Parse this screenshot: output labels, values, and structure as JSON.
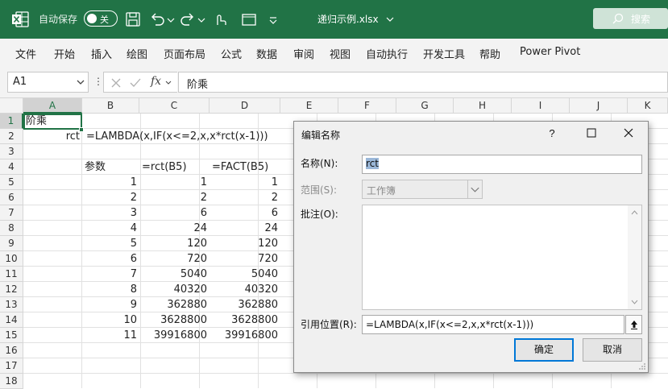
{
  "titlebar": {
    "autosave_label": "自动保存",
    "autosave_state": "关",
    "filename": "递归示例.xlsx",
    "search_label": "搜索",
    "accent": "#217346"
  },
  "menu": {
    "items": [
      "文件",
      "开始",
      "插入",
      "绘图",
      "页面布局",
      "公式",
      "数据",
      "审阅",
      "视图",
      "自动执行",
      "开发工具",
      "帮助",
      "Power Pivot"
    ]
  },
  "formula_bar": {
    "name_box": "A1",
    "dots": "⋮",
    "fx_label": "fx",
    "content": "阶乘"
  },
  "grid": {
    "columns": [
      "A",
      "B",
      "C",
      "D",
      "E",
      "F",
      "G",
      "H",
      "I",
      "J",
      "K"
    ],
    "rows": [
      "1",
      "2",
      "3",
      "4",
      "5",
      "6",
      "7",
      "8",
      "9",
      "10",
      "11",
      "12",
      "13",
      "14",
      "15",
      "16",
      "17",
      "18"
    ],
    "a1": "阶乘",
    "a2": "rct",
    "b2": "=LAMBDA(x,IF(x<=2,x,x*rct(x-1)))",
    "headers": {
      "b4": "参数",
      "c4": "=rct(B5)",
      "d4": "=FACT(B5)"
    },
    "data_rows": [
      {
        "b": "1",
        "c": "1",
        "d": "1"
      },
      {
        "b": "2",
        "c": "2",
        "d": "2"
      },
      {
        "b": "3",
        "c": "6",
        "d": "6"
      },
      {
        "b": "4",
        "c": "24",
        "d": "24"
      },
      {
        "b": "5",
        "c": "120",
        "d": "120"
      },
      {
        "b": "6",
        "c": "720",
        "d": "720"
      },
      {
        "b": "7",
        "c": "5040",
        "d": "5040"
      },
      {
        "b": "8",
        "c": "40320",
        "d": "40320"
      },
      {
        "b": "9",
        "c": "362880",
        "d": "362880"
      },
      {
        "b": "10",
        "c": "3628800",
        "d": "3628800"
      },
      {
        "b": "11",
        "c": "39916800",
        "d": "39916800"
      }
    ]
  },
  "dialog": {
    "title": "编辑名称",
    "name_label": "名称(N):",
    "name_value": "rct",
    "scope_label": "范围(S):",
    "scope_value": "工作簿",
    "comment_label": "批注(O):",
    "refers_label": "引用位置(R):",
    "refers_value": "=LAMBDA(x,IF(x<=2,x,x*rct(x-1)))",
    "ok_label": "确定",
    "cancel_label": "取消"
  }
}
